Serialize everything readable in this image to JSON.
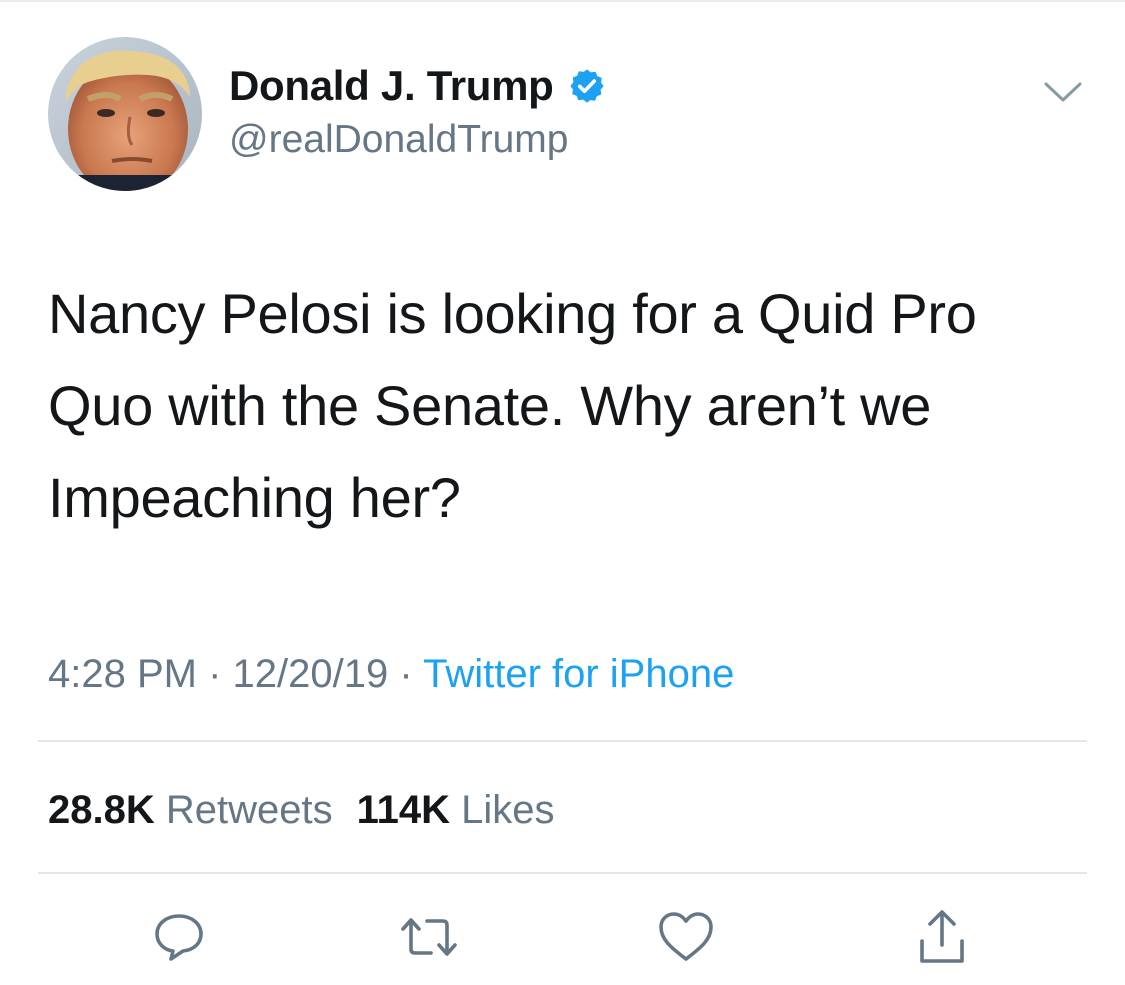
{
  "author": {
    "display_name": "Donald J. Trump",
    "handle": "@realDonaldTrump",
    "verified": true,
    "avatar_icon": "profile-photo"
  },
  "tweet": {
    "line1": "Nancy Pelosi is looking for a Quid Pro",
    "line2": "Quo with the Senate. Why aren’t we",
    "line3": "Impeaching her?"
  },
  "meta": {
    "time": "4:28 PM",
    "separator": "·",
    "date": "12/20/19",
    "source": "Twitter for iPhone"
  },
  "stats": {
    "retweets_count": "28.8K",
    "retweets_label": "Retweets",
    "likes_count": "114K",
    "likes_label": "Likes"
  },
  "actions": {
    "icons": [
      "reply-icon",
      "retweet-icon",
      "like-icon",
      "share-icon"
    ]
  },
  "colors": {
    "text": "#14171a",
    "secondary": "#657786",
    "accent": "#1da1f2",
    "divider": "#e1e8ed"
  }
}
